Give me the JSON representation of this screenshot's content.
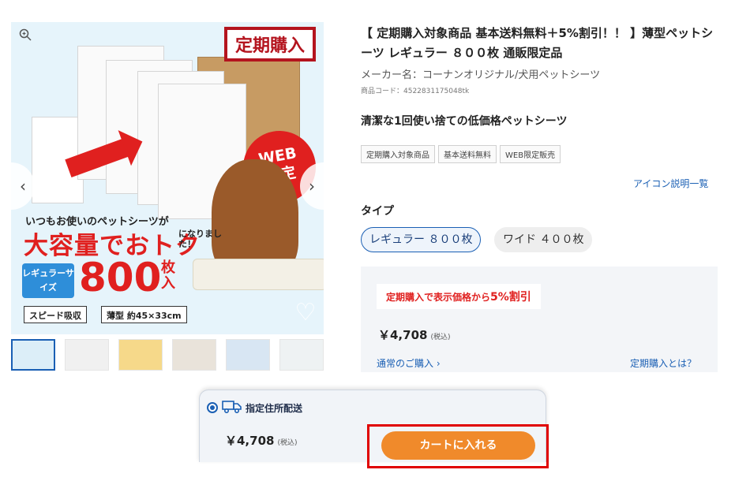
{
  "gallery": {
    "stamp_text": "定期購入",
    "web_badge": "WEB\n限定",
    "headline_small": "いつもお使いのペットシーツが",
    "headline_big": "大容量でおトク",
    "headline_note": "になりました！",
    "size_badge": "レギュラーサイズ",
    "count_number": "800",
    "count_unit": "枚入",
    "chip_speed": "スピード吸収",
    "chip_thin": "薄型 約45×33cm",
    "zoom_icon": "magnifier-icon",
    "prev_glyph": "‹",
    "next_glyph": "›",
    "heart_glyph": "♡",
    "thumbnail_count": 6
  },
  "product": {
    "title": "【 定期購入対象商品 基本送料無料＋5%割引！！ 】薄型ペットシーツ レギュラー ８００枚 通販限定品",
    "maker": "メーカー名：コーナンオリジナル/犬用ペットシーツ",
    "code": "商品コード：4522831175048tk",
    "catch": "清潔な1回使い捨ての低価格ペットシーツ",
    "tags": [
      "定期購入対象商品",
      "基本送料無料",
      "WEB限定販売"
    ],
    "icon_list_link": "アイコン説明一覧",
    "type_label": "タイプ",
    "options": [
      "レギュラー ８００枚",
      "ワイド ４００枚"
    ],
    "selected_option": "レギュラー ８００枚"
  },
  "pricing": {
    "discount_text": "定期購入で表示価格から",
    "discount_pct": "5%割引",
    "price": "￥4,708",
    "tax_note": "(税込)",
    "normal_purchase_link": "通常のご購入 ›",
    "subscription_link": "定期購入とは？"
  },
  "cart": {
    "shipping_label": "指定住所配送",
    "price": "￥4,708",
    "tax_note": "(税込)",
    "add_button": "カートに入れる"
  },
  "colors": {
    "brand_red": "#e0201f",
    "link_blue": "#1a5fb4",
    "cart_orange": "#f08a2b",
    "highlight_border": "#e00000"
  }
}
